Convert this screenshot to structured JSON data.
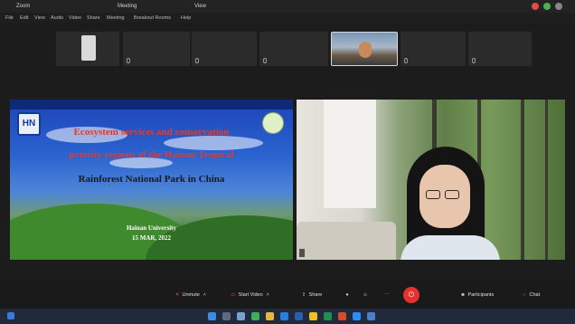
{
  "titlebar": {
    "items": [
      "Zoom",
      "Meeting",
      "View"
    ]
  },
  "menubar": {
    "items": [
      "File",
      "Edit",
      "View",
      "Audio",
      "Video",
      "Share",
      "Meeting",
      "Breakout Rooms",
      "Help"
    ]
  },
  "participants": [
    {
      "name": ""
    },
    {
      "name": ""
    },
    {
      "name": ""
    },
    {
      "name": ""
    },
    {
      "name": ""
    },
    {
      "name": ""
    },
    {
      "name": ""
    }
  ],
  "slide": {
    "logo_text": "HN",
    "title_lines": [
      "Ecosystem services and conservation",
      "priority regions of the Hainan Tropical",
      "Rainforest National Park in China"
    ],
    "subtitle_lines": [
      "Hainan University",
      "15 MAR, 2022"
    ]
  },
  "toolbar": {
    "unmute": "Unmute",
    "start_video": "Start Video",
    "share": "Share",
    "participants": "Participants",
    "chat": "Chat",
    "leave_icon": "leave-icon"
  },
  "colors": {
    "leave": "#e5322f",
    "slide_title": "#e33b2a",
    "taskbar": "#202a3a"
  }
}
